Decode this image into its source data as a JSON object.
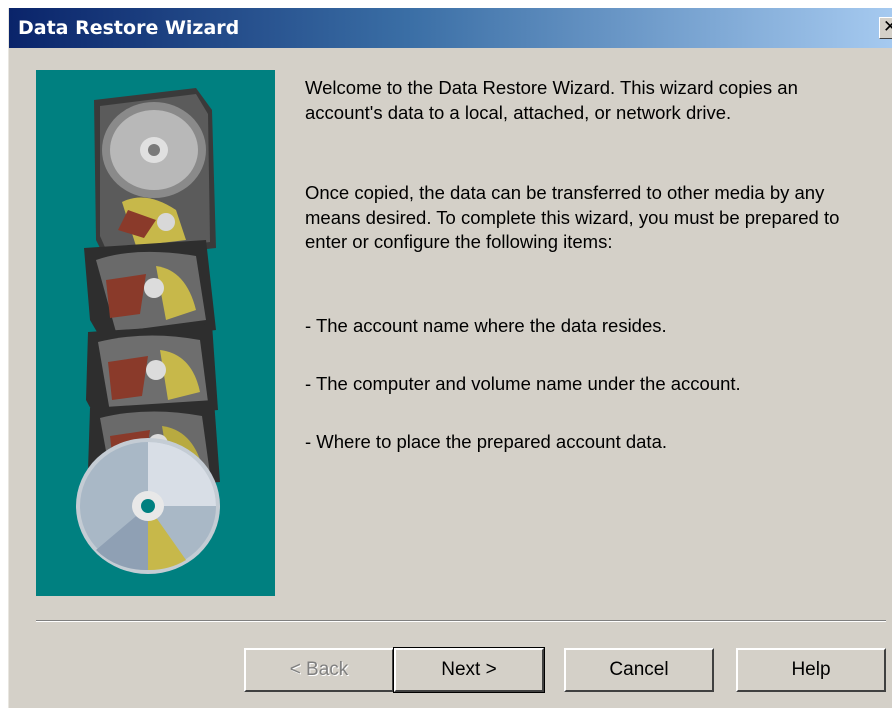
{
  "window": {
    "title": "Data Restore Wizard",
    "close_glyph": "✕"
  },
  "colors": {
    "titlebar_start": "#0a246a",
    "titlebar_end": "#a6caf0",
    "dialog_bg": "#d4d0c8",
    "side_panel_bg": "#008080"
  },
  "illustration": {
    "icon": "hard-drives-and-disc-illustration"
  },
  "content": {
    "intro": "Welcome to the Data Restore Wizard.  This wizard copies an account's data to a local, attached, or network drive.",
    "details": "Once copied, the data can be transferred to other media by any means desired.  To complete this wizard, you must be prepared to enter or configure the following items:",
    "items": [
      "- The account name where the data resides.",
      "- The computer and volume name under the account.",
      "- Where to place the prepared account data."
    ]
  },
  "buttons": {
    "back": "< Back",
    "next": "Next >",
    "cancel": "Cancel",
    "help": "Help"
  }
}
